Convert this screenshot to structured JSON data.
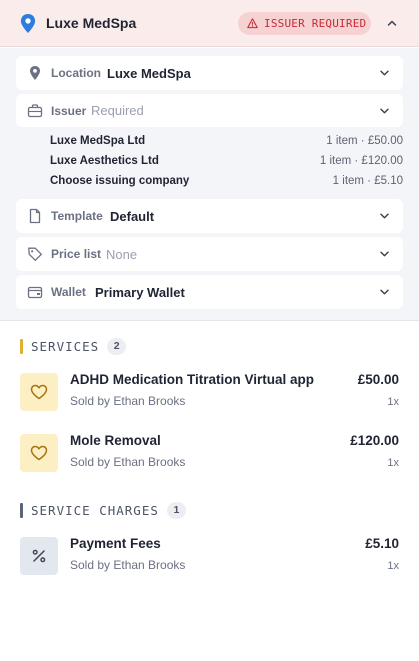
{
  "header": {
    "location_title": "Luxe MedSpa",
    "badge_text": "ISSUER REQUIRED",
    "colors": {
      "background": "#fbecec",
      "badge_bg": "#f6d2d3",
      "badge_text": "#c42c36",
      "pin": "#2b7ee0"
    }
  },
  "fields": {
    "location": {
      "label": "Location",
      "value": "Luxe MedSpa",
      "icon": "map-pin-icon"
    },
    "issuer": {
      "label": "Issuer",
      "placeholder": "Required",
      "icon": "briefcase-icon"
    },
    "template": {
      "label": "Template",
      "value": "Default",
      "icon": "file-icon"
    },
    "price_list": {
      "label": "Price list",
      "placeholder": "None",
      "icon": "tag-icon"
    },
    "wallet": {
      "label": "Wallet",
      "value": "Primary Wallet",
      "icon": "wallet-icon"
    }
  },
  "issuer_options": [
    {
      "name": "Luxe MedSpa Ltd",
      "meta": "1 item · £50.00"
    },
    {
      "name": "Luxe Aesthetics Ltd",
      "meta": "1 item · £120.00"
    },
    {
      "name": "Choose issuing company",
      "meta": "1 item · £5.10"
    }
  ],
  "services": {
    "title": "SERVICES",
    "count": "2",
    "accent": "#e0b030",
    "items": [
      {
        "name": "ADHD Medication Titration Virtual app",
        "sold_by": "Sold by Ethan Brooks",
        "price": "£50.00",
        "qty": "1x",
        "icon": "heart-icon"
      },
      {
        "name": "Mole Removal",
        "sold_by": "Sold by Ethan Brooks",
        "price": "£120.00",
        "qty": "1x",
        "icon": "heart-icon"
      }
    ]
  },
  "service_charges": {
    "title": "SERVICE CHARGES",
    "count": "1",
    "accent": "#5a6578",
    "items": [
      {
        "name": "Payment Fees",
        "sold_by": "Sold by Ethan Brooks",
        "price": "£5.10",
        "qty": "1x",
        "icon": "percent-icon"
      }
    ]
  }
}
